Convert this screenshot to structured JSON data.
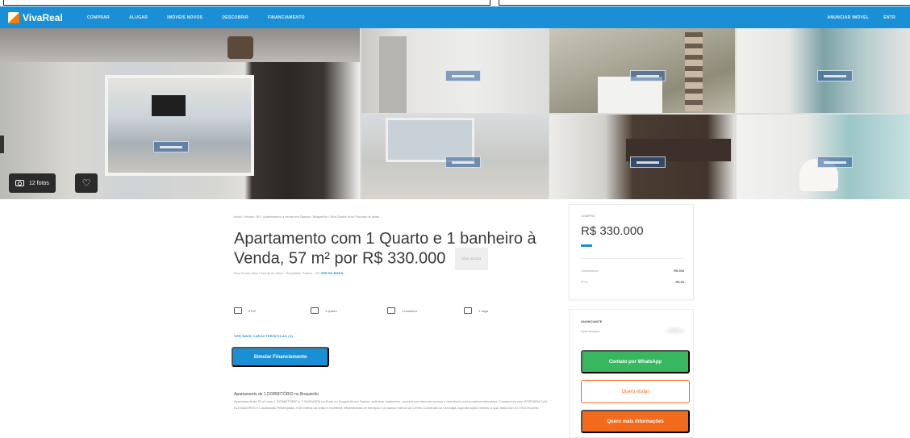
{
  "nav": {
    "logo": "VivaReal",
    "links": [
      "COMPRAR",
      "ALUGAR",
      "IMÓVEIS NOVOS",
      "DESCOBRIR",
      "FINANCIAMENTO"
    ],
    "right_links": [
      "ANUNCIAR IMÓVEL",
      "ENTR"
    ]
  },
  "gallery": {
    "photo_count": "12 fotos"
  },
  "listing": {
    "breadcrumb": "Início / Venda / SP / Apartamento à venda em Santos / Boqueirão / Rua Doutor Artur Porchat de Assis",
    "title": "Apartamento com 1 Quarto e 1 banheiro à Venda, 57 m² por R$ 330.000",
    "code": "CÓD. 871321",
    "address": "Rua Doutor Artur Porchat de Assis - Boqueirão, Santos - SP",
    "map_link": "VER NO MAPA",
    "features": [
      "57m²",
      "1 quarto",
      "1 banheiro",
      "1 vaga"
    ],
    "see_all": "VER MAIS CARACTERÍSTICAS (4)",
    "simulate_button": "Simular Financiamento",
    "description_title": "Apartamento de 1 DORMITÓRIO no Boqueirão",
    "description_text": "Apartamento de 57 m² com 1 DORMITÓRIO e 1 GARAGEM na Praia do Boqueirão em Santos, sala dois ambientes, cozinha com área de serviço e dormitório com armários embutidos. Condomínio com PORTARIA 24H, ELEVADORES e Localização Privilegiada, a 50 metros da praia e excelente infraestrutura de serviços e a poucos metros do Centro Comercial do Gonzaga. Agende agora mesmo a sua visita com a CYRA Imóveis..."
  },
  "price_card": {
    "label": "COMPRA",
    "price": "R$ 330.000",
    "rows": [
      {
        "label": "Condomínio",
        "value": "R$ 600"
      },
      {
        "label": "IPTU",
        "value": "R$ 65"
      }
    ]
  },
  "contact_card": {
    "label": "ANUNCIANTE",
    "name": "Cyra Imóveis",
    "whatsapp_button": "Contato por WhatsApp",
    "visit_button": "Quero visitar",
    "info_button": "Quero mais informações"
  },
  "colors": {
    "brand_blue": "#1b8fd6",
    "whatsapp_green": "#38b760",
    "accent_orange": "#f26a1b"
  }
}
